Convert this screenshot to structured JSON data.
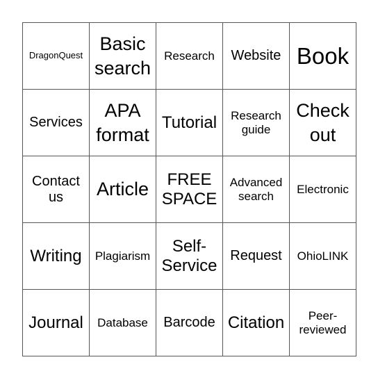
{
  "card": {
    "rows": [
      [
        {
          "text": "DragonQuest",
          "size": "xs"
        },
        {
          "text": "Basic search",
          "size": "xl"
        },
        {
          "text": "Research",
          "size": "sm"
        },
        {
          "text": "Website",
          "size": "md"
        },
        {
          "text": "Book",
          "size": "xxl"
        }
      ],
      [
        {
          "text": "Services",
          "size": "md"
        },
        {
          "text": "APA format",
          "size": "xl"
        },
        {
          "text": "Tutorial",
          "size": "lg"
        },
        {
          "text": "Research guide",
          "size": "sm"
        },
        {
          "text": "Check out",
          "size": "xl"
        }
      ],
      [
        {
          "text": "Contact us",
          "size": "md"
        },
        {
          "text": "Article",
          "size": "xl"
        },
        {
          "text": "FREE SPACE",
          "size": "lg"
        },
        {
          "text": "Advanced search",
          "size": "sm"
        },
        {
          "text": "Electronic",
          "size": "sm"
        }
      ],
      [
        {
          "text": "Writing",
          "size": "lg"
        },
        {
          "text": "Plagiarism",
          "size": "sm"
        },
        {
          "text": "Self-Service",
          "size": "lg"
        },
        {
          "text": "Request",
          "size": "md"
        },
        {
          "text": "OhioLINK",
          "size": "sm"
        }
      ],
      [
        {
          "text": "Journal",
          "size": "lg"
        },
        {
          "text": "Database",
          "size": "sm"
        },
        {
          "text": "Barcode",
          "size": "md"
        },
        {
          "text": "Citation",
          "size": "lg"
        },
        {
          "text": "Peer-reviewed",
          "size": "sm"
        }
      ]
    ]
  }
}
